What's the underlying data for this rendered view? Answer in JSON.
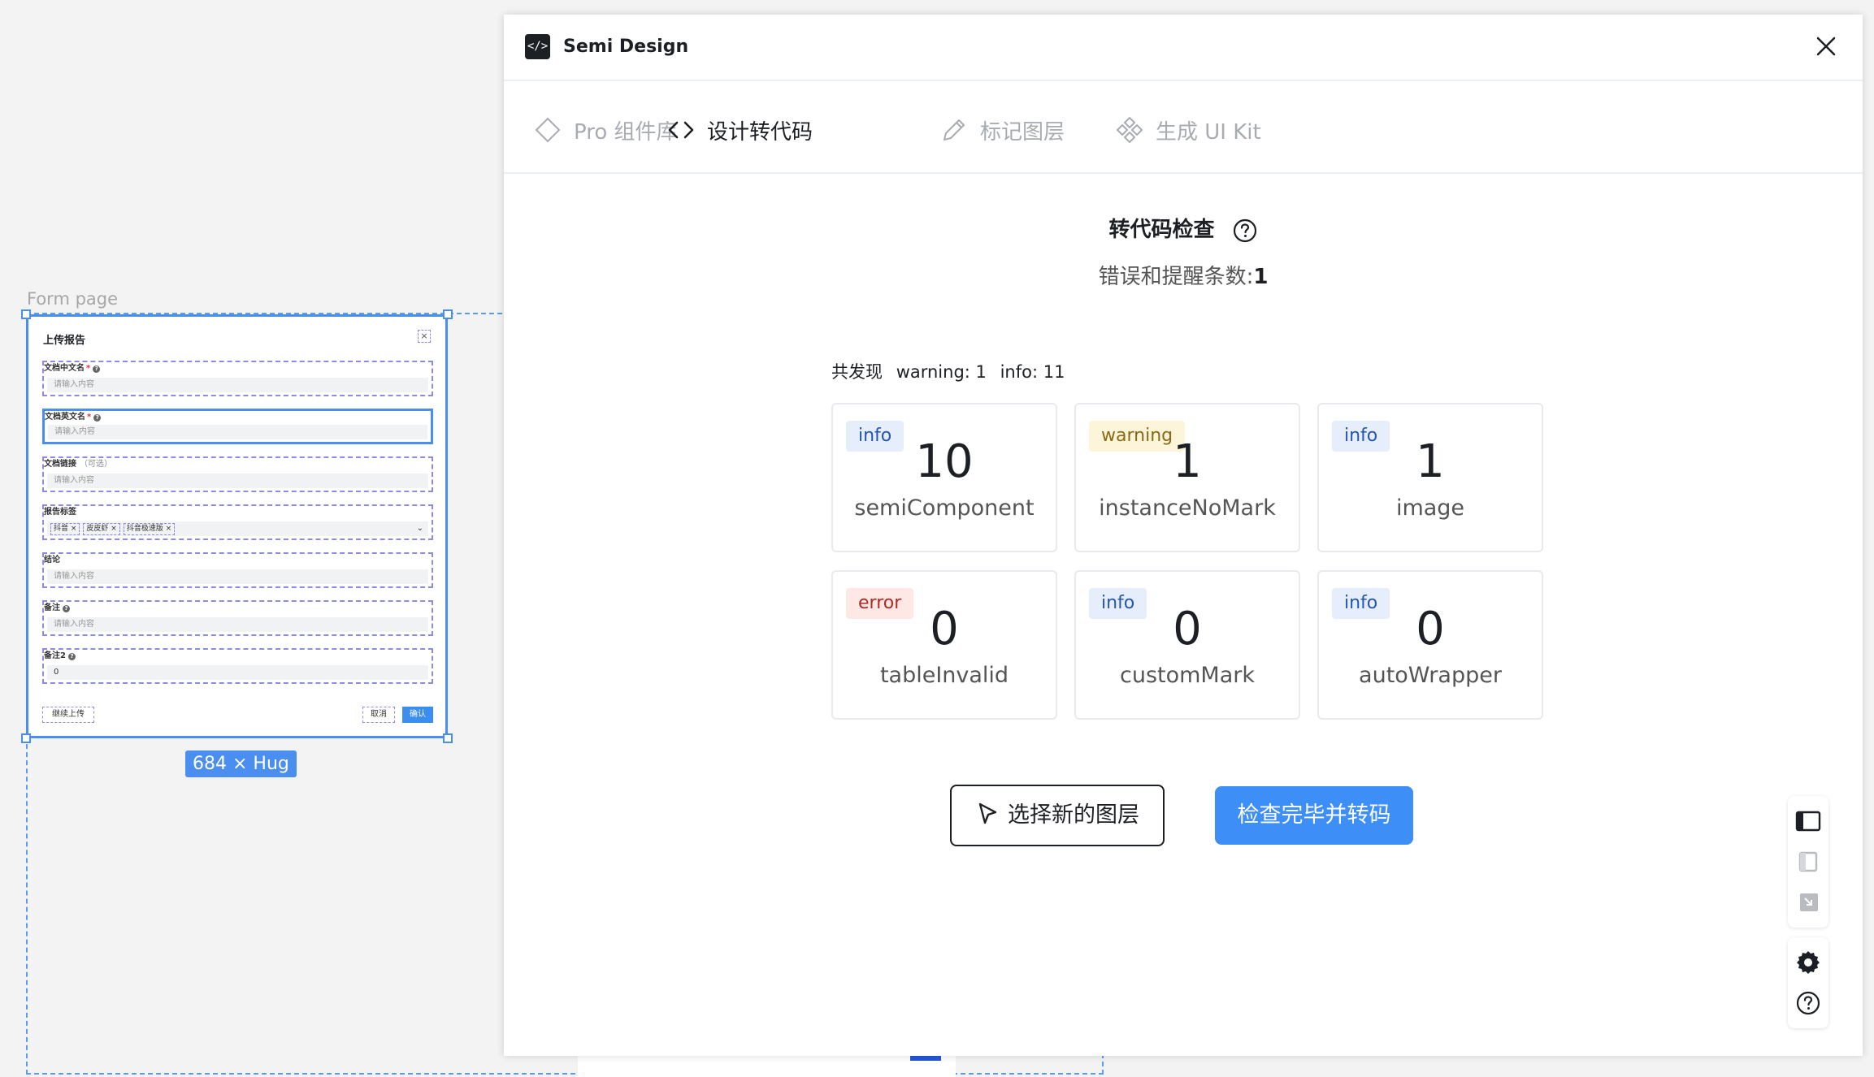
{
  "canvas": {
    "frame_label": "Form page",
    "size_badge": "684 × Hug"
  },
  "form": {
    "title": "上传报告",
    "fields": [
      {
        "label": "文档中文名",
        "required": "*",
        "placeholder": "请输入内容"
      },
      {
        "label": "文档英文名",
        "required": "*",
        "placeholder": "请输入内容"
      },
      {
        "label": "文档链接",
        "optional": "（可选）",
        "placeholder": "请输入内容"
      },
      {
        "label": "报告标签",
        "tags": [
          "抖音 ×",
          "皮皮虾 ×",
          "抖音极速版 ×"
        ]
      },
      {
        "label": "结论",
        "placeholder": "请输入内容"
      },
      {
        "label": "备注",
        "placeholder": "请输入内容"
      },
      {
        "label": "备注2",
        "value": "0"
      }
    ],
    "continue_label": "继续上传",
    "cancel_label": "取消",
    "confirm_label": "确认"
  },
  "modal": {
    "logo": "</>",
    "title": "Semi Design",
    "tabs": [
      {
        "label": "Pro 组件库",
        "icon": "diamond-icon"
      },
      {
        "label": "设计转代码",
        "icon": "code-icon"
      },
      {
        "label": "标记图层",
        "icon": "pencil-icon"
      },
      {
        "label": "生成 UI Kit",
        "icon": "component-icon"
      }
    ],
    "active_tab": "设计转代码",
    "check": {
      "title": "转代码检查",
      "count_label": "错误和提醒条数:",
      "count_value": "1",
      "summary_prefix": "共发现",
      "summary_warning": "warning: 1",
      "summary_info": "info: 11"
    },
    "cards": [
      {
        "level": "info",
        "count": "10",
        "name": "semiComponent"
      },
      {
        "level": "warning",
        "count": "1",
        "name": "instanceNoMark"
      },
      {
        "level": "info",
        "count": "1",
        "name": "image"
      },
      {
        "level": "error",
        "count": "0",
        "name": "tableInvalid"
      },
      {
        "level": "info",
        "count": "0",
        "name": "customMark"
      },
      {
        "level": "info",
        "count": "0",
        "name": "autoWrapper"
      }
    ],
    "buttons": {
      "select_layer": "选择新的图层",
      "finish_convert": "检查完毕并转码"
    }
  },
  "colors": {
    "primary": "#3e8ef7",
    "selection": "#4a8ef0",
    "info_bg": "#e6edfb",
    "warning_bg": "#fdf5da",
    "error_bg": "#fde8e6"
  }
}
